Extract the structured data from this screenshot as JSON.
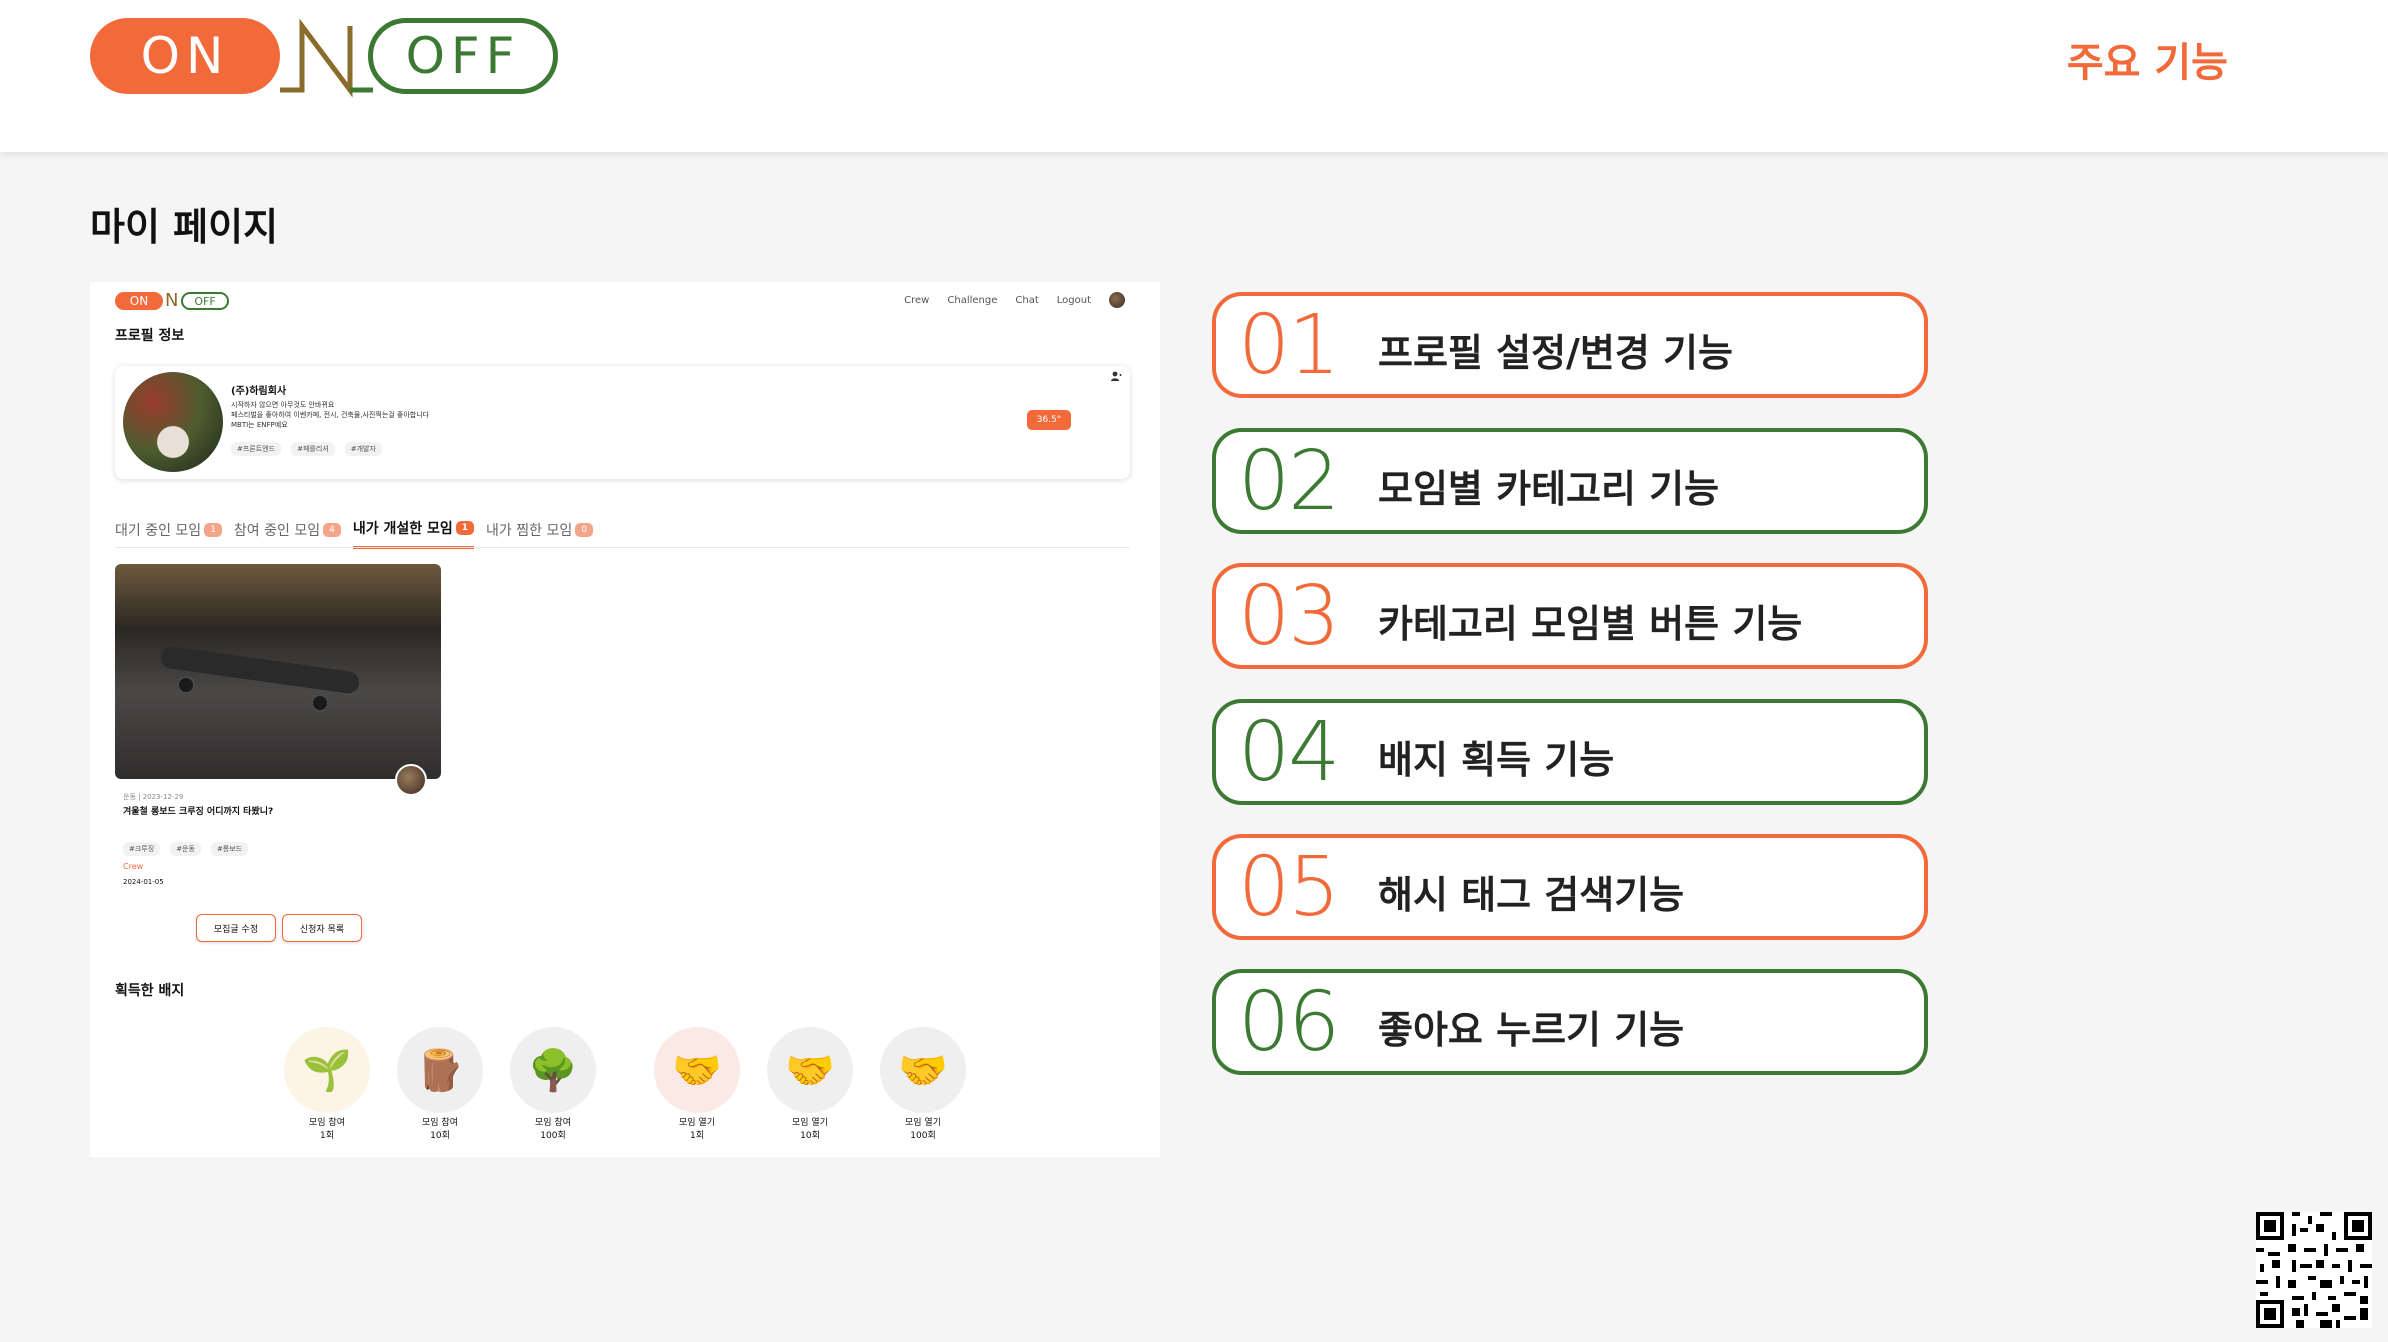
{
  "header": {
    "logo": {
      "on": "ON",
      "off": "OFF"
    },
    "nav_feature": "주요 기능"
  },
  "page_title": "마이 페이지",
  "mock": {
    "logo": {
      "on": "ON",
      "n": "N",
      "off": "OFF"
    },
    "nav": [
      "Crew",
      "Challenge",
      "Chat",
      "Logout"
    ],
    "section_title": "프로필 정보",
    "profile": {
      "name": "(주)하림회사",
      "desc": "시작하자 않으면 아무것도 안바뀌요\n페스티벌을 좋아하여 이벤카페, 전시, 건축물,사진찍는걸 좋아합니다\nMBTI는 ENFP예요",
      "tags": [
        "#프론트엔드",
        "#페를리셔",
        "#개발자"
      ],
      "temperature": "36.5°"
    },
    "tabs": [
      {
        "label": "대기 중인 모임",
        "count": "1",
        "active": false
      },
      {
        "label": "참여 중인 모임",
        "count": "4",
        "active": false
      },
      {
        "label": "내가 개설한 모임",
        "count": "1",
        "active": true
      },
      {
        "label": "내가 찜한 모임",
        "count": "0",
        "active": false
      }
    ],
    "meeting": {
      "meta": "운동 | 2023-12-29",
      "title": "겨울철 롱보드 크루징 어디까지 타봤니?",
      "tags": [
        "#크루징",
        "#운동",
        "#롱보드"
      ],
      "crew": "Crew",
      "date": "2024-01-05",
      "edit_button": "모집글 수정",
      "applicants_button": "신청자 목록"
    },
    "badges_title": "획득한 배지",
    "badges": [
      {
        "icon": "sprout-icon",
        "label1": "모임 참여",
        "label2": "1회",
        "bg": "#fdf4e6"
      },
      {
        "icon": "stump-icon",
        "label1": "모임 참여",
        "label2": "10회",
        "bg": "#efefef"
      },
      {
        "icon": "tree-icon",
        "label1": "모임 참여",
        "label2": "100회",
        "bg": "#efefef"
      },
      {
        "icon": "handshake-icon",
        "label1": "모임 열기",
        "label2": "1회",
        "bg": "#fbe9e5"
      },
      {
        "icon": "handshake-icon",
        "label1": "모임 열기",
        "label2": "10회",
        "bg": "#efefef"
      },
      {
        "icon": "handshake-icon",
        "label1": "모임 열기",
        "label2": "100회",
        "bg": "#efefef"
      }
    ]
  },
  "features": [
    {
      "num": "01",
      "text": "프로필 설정/변경 기능",
      "color": "orange"
    },
    {
      "num": "02",
      "text": "모임별 카테고리 기능",
      "color": "green"
    },
    {
      "num": "03",
      "text": "카테고리 모임별 버튼 기능",
      "color": "orange"
    },
    {
      "num": "04",
      "text": "배지 획득 기능",
      "color": "green"
    },
    {
      "num": "05",
      "text": "해시 태그 검색기능",
      "color": "orange"
    },
    {
      "num": "06",
      "text": "좋아요 누르기 기능",
      "color": "green"
    }
  ],
  "colors": {
    "accent": "#f26a3a",
    "green": "#3c7a34"
  }
}
